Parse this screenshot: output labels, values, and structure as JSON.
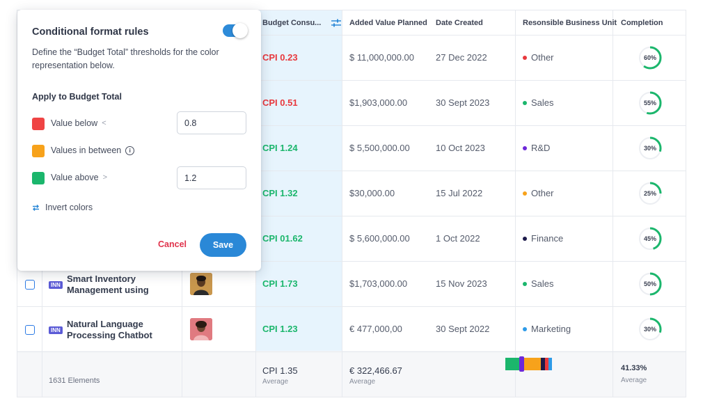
{
  "header": {
    "budget_col": "Budget Consu...",
    "added_value": "Added Value Planned",
    "date_created": "Date Created",
    "business_unit": "Resonsible Business Unit",
    "completion": "Completion"
  },
  "rows": [
    {
      "cpi": "CPI 0.23",
      "cpi_status": "red",
      "added": "$ 11,000,000.00",
      "date": "27 Dec 2022",
      "unit": "Other",
      "unit_color": "#e8383d",
      "completion": "60%",
      "completion_value": 60
    },
    {
      "cpi": "CPI 0.51",
      "cpi_status": "red",
      "added": "$1,903,000.00",
      "date": "30 Sept 2023",
      "unit": "Sales",
      "unit_color": "#1bb66c",
      "completion": "55%",
      "completion_value": 55
    },
    {
      "cpi": "CPI 1.24",
      "cpi_status": "green",
      "added": "$ 5,500,000.00",
      "date": "10 Oct 2023",
      "unit": "R&D",
      "unit_color": "#6d28d9",
      "completion": "30%",
      "completion_value": 30
    },
    {
      "cpi": "CPI 1.32",
      "cpi_status": "green",
      "added": "$30,000.00",
      "date": "15 Jul 2022",
      "unit": "Other",
      "unit_color": "#f7a21b",
      "completion": "25%",
      "completion_value": 25
    },
    {
      "cpi": "CPI 01.62",
      "cpi_status": "green",
      "added": "$ 5,600,000.00",
      "date": "1 Oct 2022",
      "unit": "Finance",
      "unit_color": "#1d1b4b",
      "completion": "45%",
      "completion_value": 45
    },
    {
      "cpi": "CPI 1.73",
      "cpi_status": "green",
      "added": "$1,703,000.00",
      "date": "15 Nov 2023",
      "unit": "Sales",
      "unit_color": "#1bb66c",
      "completion": "50%",
      "completion_value": 50,
      "project_tag": "INN",
      "project_name": "Smart Inventory Management using"
    },
    {
      "cpi": "CPI 1.23",
      "cpi_status": "green",
      "added": "€ 477,000,00",
      "date": "30 Sept 2022",
      "unit": "Marketing",
      "unit_color": "#2d9be8",
      "completion": "30%",
      "completion_value": 30,
      "project_tag": "INN",
      "project_name": "Natural Language Processing Chatbot"
    }
  ],
  "footer": {
    "elements": "1631 Elements",
    "cpi_avg": "CPI 1.35",
    "cpi_avg_label": "Average",
    "added_avg": "€ 322,466.67",
    "added_avg_label": "Average",
    "completion_avg": "41.33%",
    "completion_avg_label": "Average",
    "unit_distribution": [
      {
        "color": "#1bb66c",
        "share": 0.28
      },
      {
        "color": "#6d28d9",
        "share": 0.1
      },
      {
        "color": "#f7a21b",
        "share": 0.33
      },
      {
        "color": "#1d1b4b",
        "share": 0.08
      },
      {
        "color": "#e8383d",
        "share": 0.07
      },
      {
        "color": "#2d9be8",
        "share": 0.07
      }
    ]
  },
  "popover": {
    "title": "Conditional format rules",
    "toggle_on": true,
    "description": "Define the “Budget Total” thresholds for the color representation below.",
    "subtitle": "Apply to Budget Total",
    "rules": [
      {
        "label": "Value below",
        "symbol": "<",
        "color": "#ef4444",
        "value": "0.8"
      },
      {
        "label": "Values in between",
        "color": "#f7a21b"
      },
      {
        "label": "Value above",
        "symbol": ">",
        "color": "#1bb66c",
        "value": "1.2"
      }
    ],
    "invert_label": "Invert colors",
    "cancel_label": "Cancel",
    "save_label": "Save"
  },
  "colors": {
    "accent": "#2a88d7",
    "danger": "#e0334c",
    "success": "#1bb66c",
    "budget_col_bg": "#e7f4fd"
  }
}
